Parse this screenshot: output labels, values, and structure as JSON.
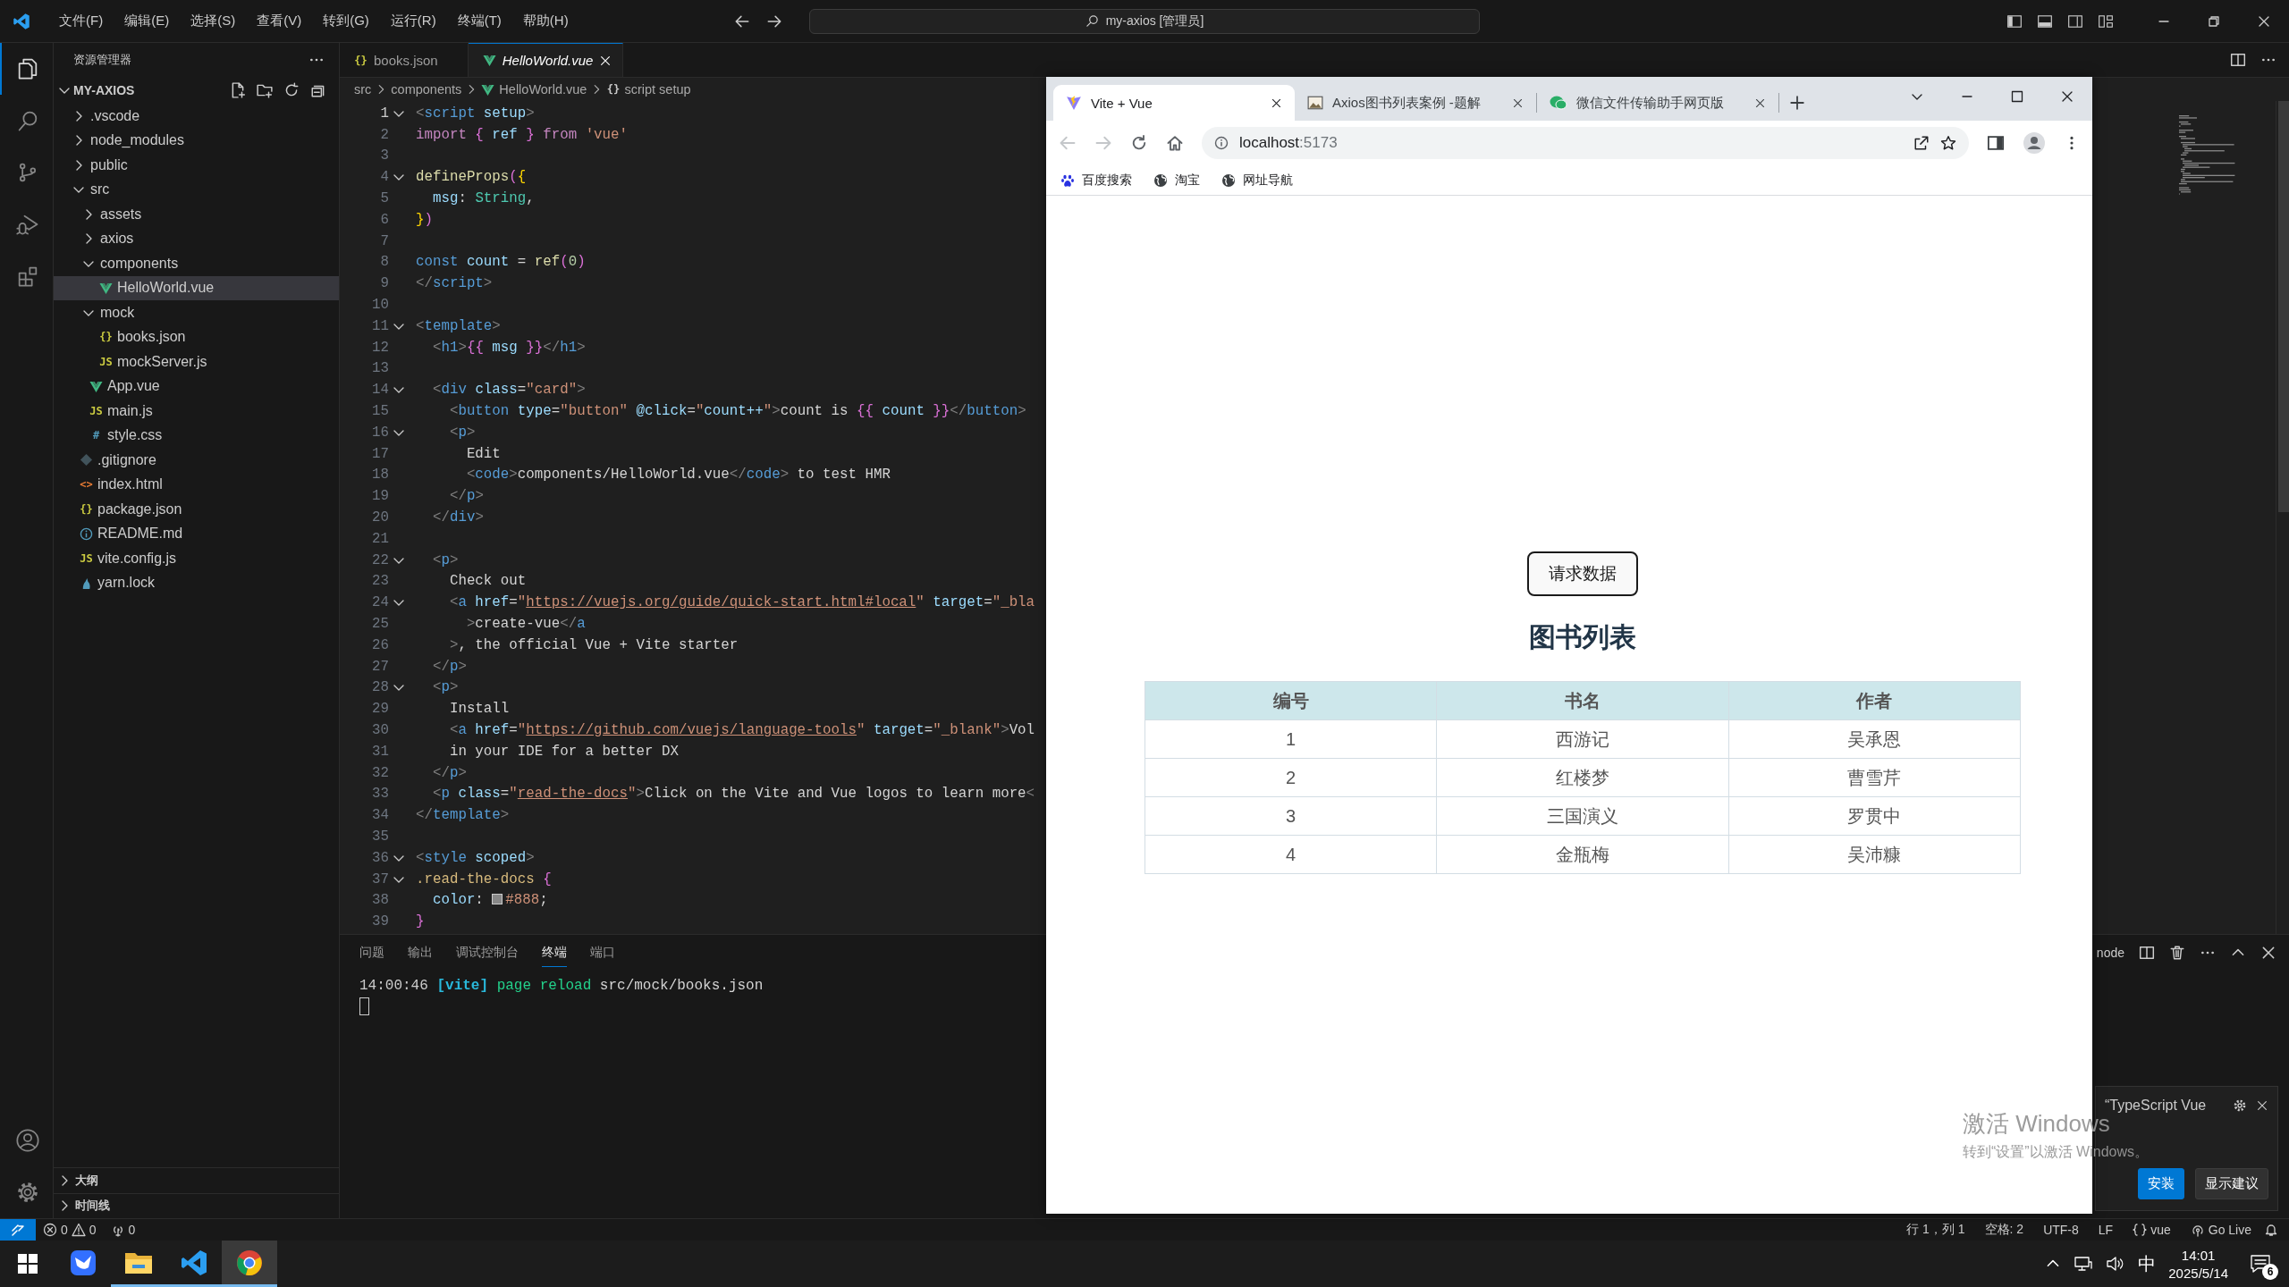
{
  "title_bar": {
    "menus": [
      "文件(F)",
      "编辑(E)",
      "选择(S)",
      "查看(V)",
      "转到(G)",
      "运行(R)",
      "终端(T)",
      "帮助(H)"
    ],
    "search": "my-axios [管理员]"
  },
  "activity_bar": {
    "items": [
      {
        "kind": "files",
        "selected": true
      },
      {
        "kind": "search",
        "selected": false
      },
      {
        "kind": "scm",
        "selected": false
      },
      {
        "kind": "debug",
        "selected": false
      },
      {
        "kind": "extensions",
        "selected": false
      }
    ]
  },
  "sidebar": {
    "title": "资源管理器",
    "project": "MY-AXIOS",
    "tree": [
      {
        "name": ".vscode",
        "kind": "folder",
        "expanded": false,
        "selected": false
      },
      {
        "name": "node_modules",
        "kind": "folder",
        "expanded": false,
        "selected": false
      },
      {
        "name": "public",
        "kind": "folder",
        "expanded": false,
        "selected": false
      },
      {
        "name": "src",
        "kind": "folder",
        "expanded": true,
        "selected": false,
        "children": [
          {
            "name": "assets",
            "kind": "folder",
            "expanded": false,
            "selected": false
          },
          {
            "name": "axios",
            "kind": "folder",
            "expanded": false,
            "selected": false
          },
          {
            "name": "components",
            "kind": "folder",
            "expanded": true,
            "selected": false,
            "children": [
              {
                "name": "HelloWorld.vue",
                "kind": "vue",
                "selected": true
              }
            ]
          },
          {
            "name": "mock",
            "kind": "folder",
            "expanded": true,
            "selected": false,
            "children": [
              {
                "name": "books.json",
                "kind": "json",
                "icon": "{}",
                "selected": false
              },
              {
                "name": "mockServer.js",
                "kind": "js",
                "icon": "JS",
                "selected": false
              }
            ]
          },
          {
            "name": "App.vue",
            "kind": "vue",
            "selected": false
          },
          {
            "name": "main.js",
            "kind": "js",
            "icon": "JS",
            "selected": false
          },
          {
            "name": "style.css",
            "kind": "css",
            "icon": "#",
            "selected": false
          }
        ]
      },
      {
        "name": ".gitignore",
        "kind": "git",
        "selected": false
      },
      {
        "name": "index.html",
        "kind": "html",
        "icon": "<>",
        "selected": false
      },
      {
        "name": "package.json",
        "kind": "json",
        "icon": "{}",
        "selected": false
      },
      {
        "name": "README.md",
        "kind": "info",
        "selected": false
      },
      {
        "name": "vite.config.js",
        "kind": "js",
        "icon": "JS",
        "selected": false
      },
      {
        "name": "yarn.lock",
        "kind": "yarn",
        "selected": false
      }
    ],
    "sections": [
      {
        "label": "大纲",
        "expanded": false
      },
      {
        "label": "时间线",
        "expanded": false
      }
    ]
  },
  "editor": {
    "tabs": [
      {
        "label": "books.json",
        "kind": "json",
        "icon": "{}",
        "selected": false,
        "preview": false
      },
      {
        "label": "HelloWorld.vue",
        "kind": "vue",
        "selected": true,
        "preview": true
      }
    ],
    "breadcrumb": [
      {
        "label": "src",
        "kind": "folder"
      },
      {
        "label": "components",
        "kind": "folder"
      },
      {
        "label": "HelloWorld.vue",
        "kind": "vue"
      },
      {
        "label": "script setup",
        "kind": "symbol",
        "icon": "{}"
      }
    ],
    "lines": [
      {
        "n": "1",
        "foldable": true,
        "tokens": [
          {
            "kind": "br",
            "text": "<"
          },
          {
            "kind": "tag",
            "text": "script"
          },
          {
            "kind": "attr",
            "text": " setup"
          },
          {
            "kind": "br",
            "text": ">"
          }
        ]
      },
      {
        "n": "2",
        "foldable": false,
        "tokens": [
          {
            "kind": "kw",
            "text": "import "
          },
          {
            "kind": "brace",
            "text": "{"
          },
          {
            "kind": "var",
            "text": " ref "
          },
          {
            "kind": "brace",
            "text": "}"
          },
          {
            "kind": "kw",
            "text": " from "
          },
          {
            "kind": "str",
            "text": "'vue'"
          }
        ]
      },
      {
        "n": "3",
        "foldable": false
      },
      {
        "n": "4",
        "foldable": true,
        "tokens": [
          {
            "kind": "fn",
            "text": "defineProps"
          },
          {
            "kind": "brace",
            "text": "("
          },
          {
            "kind": "brace2",
            "text": "{"
          }
        ]
      },
      {
        "n": "5",
        "foldable": false,
        "tokens": [
          {
            "kind": "var",
            "text": "  msg"
          },
          {
            "kind": "txt",
            "text": ": "
          },
          {
            "kind": "type",
            "text": "String"
          },
          {
            "kind": "txt",
            "text": ","
          }
        ]
      },
      {
        "n": "6",
        "foldable": false,
        "tokens": [
          {
            "kind": "brace2",
            "text": "}"
          },
          {
            "kind": "brace",
            "text": ")"
          }
        ]
      },
      {
        "n": "7",
        "foldable": false
      },
      {
        "n": "8",
        "foldable": false,
        "tokens": [
          {
            "kind": "tag",
            "text": "const"
          },
          {
            "kind": "var",
            "text": " count"
          },
          {
            "kind": "txt",
            "text": " = "
          },
          {
            "kind": "fn",
            "text": "ref"
          },
          {
            "kind": "brace",
            "text": "("
          },
          {
            "kind": "num",
            "text": "0"
          },
          {
            "kind": "brace",
            "text": ")"
          }
        ]
      },
      {
        "n": "9",
        "foldable": false,
        "tokens": [
          {
            "kind": "br",
            "text": "</"
          },
          {
            "kind": "tag",
            "text": "script"
          },
          {
            "kind": "br",
            "text": ">"
          }
        ]
      },
      {
        "n": "10",
        "foldable": false
      },
      {
        "n": "11",
        "foldable": true,
        "tokens": [
          {
            "kind": "br",
            "text": "<"
          },
          {
            "kind": "tag",
            "text": "template"
          },
          {
            "kind": "br",
            "text": ">"
          }
        ]
      },
      {
        "n": "12",
        "foldable": false,
        "tokens": [
          {
            "kind": "br",
            "text": "  <"
          },
          {
            "kind": "tag",
            "text": "h1"
          },
          {
            "kind": "br",
            "text": ">"
          },
          {
            "kind": "brace",
            "text": "{{"
          },
          {
            "kind": "var",
            "text": " msg "
          },
          {
            "kind": "brace",
            "text": "}}"
          },
          {
            "kind": "br",
            "text": "</"
          },
          {
            "kind": "tag",
            "text": "h1"
          },
          {
            "kind": "br",
            "text": ">"
          }
        ]
      },
      {
        "n": "13",
        "foldable": false
      },
      {
        "n": "14",
        "foldable": true,
        "tokens": [
          {
            "kind": "br",
            "text": "  <"
          },
          {
            "kind": "tag",
            "text": "div"
          },
          {
            "kind": "attr",
            "text": " class"
          },
          {
            "kind": "txt",
            "text": "="
          },
          {
            "kind": "str",
            "text": "\"card\""
          },
          {
            "kind": "br",
            "text": ">"
          }
        ]
      },
      {
        "n": "15",
        "foldable": false,
        "tokens": [
          {
            "kind": "br",
            "text": "    <"
          },
          {
            "kind": "tag",
            "text": "button"
          },
          {
            "kind": "attr",
            "text": " type"
          },
          {
            "kind": "txt",
            "text": "="
          },
          {
            "kind": "str",
            "text": "\"button\""
          },
          {
            "kind": "attr",
            "text": " @click"
          },
          {
            "kind": "txt",
            "text": "="
          },
          {
            "kind": "str",
            "text": "\""
          },
          {
            "kind": "var",
            "text": "count++"
          },
          {
            "kind": "str",
            "text": "\""
          },
          {
            "kind": "br",
            "text": ">"
          },
          {
            "kind": "txt",
            "text": "count is "
          },
          {
            "kind": "brace",
            "text": "{{"
          },
          {
            "kind": "var",
            "text": " count "
          },
          {
            "kind": "brace",
            "text": "}}"
          },
          {
            "kind": "br",
            "text": "</"
          },
          {
            "kind": "tag",
            "text": "button"
          },
          {
            "kind": "br",
            "text": ">"
          }
        ]
      },
      {
        "n": "16",
        "foldable": true,
        "tokens": [
          {
            "kind": "br",
            "text": "    <"
          },
          {
            "kind": "tag",
            "text": "p"
          },
          {
            "kind": "br",
            "text": ">"
          }
        ]
      },
      {
        "n": "17",
        "foldable": false,
        "tokens": [
          {
            "kind": "txt",
            "text": "      Edit"
          }
        ]
      },
      {
        "n": "18",
        "foldable": false,
        "tokens": [
          {
            "kind": "br",
            "text": "      <"
          },
          {
            "kind": "tag",
            "text": "code"
          },
          {
            "kind": "br",
            "text": ">"
          },
          {
            "kind": "txt",
            "text": "components/HelloWorld.vue"
          },
          {
            "kind": "br",
            "text": "</"
          },
          {
            "kind": "tag",
            "text": "code"
          },
          {
            "kind": "br",
            "text": ">"
          },
          {
            "kind": "txt",
            "text": " to test HMR"
          }
        ]
      },
      {
        "n": "19",
        "foldable": false,
        "tokens": [
          {
            "kind": "br",
            "text": "    </"
          },
          {
            "kind": "tag",
            "text": "p"
          },
          {
            "kind": "br",
            "text": ">"
          }
        ]
      },
      {
        "n": "20",
        "foldable": false,
        "tokens": [
          {
            "kind": "br",
            "text": "  </"
          },
          {
            "kind": "tag",
            "text": "div"
          },
          {
            "kind": "br",
            "text": ">"
          }
        ]
      },
      {
        "n": "21",
        "foldable": false
      },
      {
        "n": "22",
        "foldable": true,
        "tokens": [
          {
            "kind": "br",
            "text": "  <"
          },
          {
            "kind": "tag",
            "text": "p"
          },
          {
            "kind": "br",
            "text": ">"
          }
        ]
      },
      {
        "n": "23",
        "foldable": false,
        "tokens": [
          {
            "kind": "txt",
            "text": "    Check out"
          }
        ]
      },
      {
        "n": "24",
        "foldable": true,
        "tokens": [
          {
            "kind": "br",
            "text": "    <"
          },
          {
            "kind": "tag",
            "text": "a"
          },
          {
            "kind": "attr",
            "text": " href"
          },
          {
            "kind": "txt",
            "text": "="
          },
          {
            "kind": "str",
            "text": "\""
          },
          {
            "kind": "link",
            "text": "https://vuejs.org/guide/quick-start.html#local"
          },
          {
            "kind": "str",
            "text": "\""
          },
          {
            "kind": "attr",
            "text": " target"
          },
          {
            "kind": "txt",
            "text": "="
          },
          {
            "kind": "str",
            "text": "\"_bla"
          }
        ]
      },
      {
        "n": "25",
        "foldable": false,
        "tokens": [
          {
            "kind": "br",
            "text": "      >"
          },
          {
            "kind": "txt",
            "text": "create-vue"
          },
          {
            "kind": "br",
            "text": "</"
          },
          {
            "kind": "tag",
            "text": "a"
          }
        ]
      },
      {
        "n": "26",
        "foldable": false,
        "tokens": [
          {
            "kind": "br",
            "text": "    >"
          },
          {
            "kind": "txt",
            "text": ", the official Vue + Vite starter"
          }
        ]
      },
      {
        "n": "27",
        "foldable": false,
        "tokens": [
          {
            "kind": "br",
            "text": "  </"
          },
          {
            "kind": "tag",
            "text": "p"
          },
          {
            "kind": "br",
            "text": ">"
          }
        ]
      },
      {
        "n": "28",
        "foldable": true,
        "tokens": [
          {
            "kind": "br",
            "text": "  <"
          },
          {
            "kind": "tag",
            "text": "p"
          },
          {
            "kind": "br",
            "text": ">"
          }
        ]
      },
      {
        "n": "29",
        "foldable": false,
        "tokens": [
          {
            "kind": "txt",
            "text": "    Install"
          }
        ]
      },
      {
        "n": "30",
        "foldable": false,
        "tokens": [
          {
            "kind": "br",
            "text": "    <"
          },
          {
            "kind": "tag",
            "text": "a"
          },
          {
            "kind": "attr",
            "text": " href"
          },
          {
            "kind": "txt",
            "text": "="
          },
          {
            "kind": "str",
            "text": "\""
          },
          {
            "kind": "link",
            "text": "https://github.com/vuejs/language-tools"
          },
          {
            "kind": "str",
            "text": "\""
          },
          {
            "kind": "attr",
            "text": " target"
          },
          {
            "kind": "txt",
            "text": "="
          },
          {
            "kind": "str",
            "text": "\"_blank\""
          },
          {
            "kind": "br",
            "text": ">"
          },
          {
            "kind": "txt",
            "text": "Vol"
          }
        ]
      },
      {
        "n": "31",
        "foldable": false,
        "tokens": [
          {
            "kind": "txt",
            "text": "    in your IDE for a better DX"
          }
        ]
      },
      {
        "n": "32",
        "foldable": false,
        "tokens": [
          {
            "kind": "br",
            "text": "  </"
          },
          {
            "kind": "tag",
            "text": "p"
          },
          {
            "kind": "br",
            "text": ">"
          }
        ]
      },
      {
        "n": "33",
        "foldable": false,
        "tokens": [
          {
            "kind": "br",
            "text": "  <"
          },
          {
            "kind": "tag",
            "text": "p"
          },
          {
            "kind": "attr",
            "text": " class"
          },
          {
            "kind": "txt",
            "text": "="
          },
          {
            "kind": "str",
            "text": "\""
          },
          {
            "kind": "link",
            "text": "read-the-docs"
          },
          {
            "kind": "str",
            "text": "\""
          },
          {
            "kind": "br",
            "text": ">"
          },
          {
            "kind": "txt",
            "text": "Click on the Vite and Vue logos to learn more"
          },
          {
            "kind": "br",
            "text": "<"
          }
        ]
      },
      {
        "n": "34",
        "foldable": false,
        "tokens": [
          {
            "kind": "br",
            "text": "</"
          },
          {
            "kind": "tag",
            "text": "template"
          },
          {
            "kind": "br",
            "text": ">"
          }
        ]
      },
      {
        "n": "35",
        "foldable": false
      },
      {
        "n": "36",
        "foldable": true,
        "tokens": [
          {
            "kind": "br",
            "text": "<"
          },
          {
            "kind": "tag",
            "text": "style"
          },
          {
            "kind": "attr",
            "text": " scoped"
          },
          {
            "kind": "br",
            "text": ">"
          }
        ]
      },
      {
        "n": "37",
        "foldable": true,
        "tokens": [
          {
            "kind": "sel",
            "text": ".read-the-docs "
          },
          {
            "kind": "brace",
            "text": "{"
          }
        ]
      },
      {
        "n": "38",
        "foldable": false,
        "tokens": [
          {
            "kind": "prop",
            "text": "  color"
          },
          {
            "kind": "txt",
            "text": ": "
          },
          {
            "kind": "swatch",
            "text": "#888"
          },
          {
            "kind": "txt",
            "text": ";"
          }
        ]
      },
      {
        "n": "39",
        "foldable": false,
        "tokens": [
          {
            "kind": "brace",
            "text": "}"
          }
        ]
      }
    ]
  },
  "panel": {
    "tabs": [
      {
        "label": "问题",
        "selected": false
      },
      {
        "label": "输出",
        "selected": false
      },
      {
        "label": "调试控制台",
        "selected": false
      },
      {
        "label": "终端",
        "selected": true
      },
      {
        "label": "端口",
        "selected": false
      }
    ],
    "terminal_name": "node",
    "terminal": [
      {
        "kind": "time",
        "text": "14:00:46 "
      },
      {
        "kind": "vite",
        "text": "[vite]"
      },
      {
        "kind": "green",
        "text": " page reload"
      },
      {
        "kind": "txt",
        "text": " src/mock/books.json"
      }
    ]
  },
  "status_bar": {
    "errors": "0",
    "warnings": "0",
    "ports": "0",
    "right": [
      {
        "kind": "text",
        "label": "行 1，列 1"
      },
      {
        "kind": "text",
        "label": "空格: 2"
      },
      {
        "kind": "text",
        "label": "UTF-8"
      },
      {
        "kind": "text",
        "label": "LF"
      },
      {
        "kind": "language",
        "label": "vue"
      },
      {
        "kind": "live",
        "label": "Go Live"
      }
    ]
  },
  "notification": {
    "text": "“TypeScript Vue",
    "buttons": [
      {
        "label": "安装",
        "primary": true
      },
      {
        "label": "显示建议",
        "primary": false
      }
    ]
  },
  "activation": {
    "title": "激活 Windows",
    "hint": "转到“设置”以激活 Windows。"
  },
  "browser": {
    "tabs": [
      {
        "title": "Vite + Vue",
        "kind": "vite",
        "selected": true
      },
      {
        "title": "Axios图书列表案例 -题解",
        "kind": "picture",
        "selected": false
      },
      {
        "title": "微信文件传输助手网页版",
        "kind": "wechat",
        "selected": false
      }
    ],
    "address": {
      "host": "localhost",
      "port": ":5173"
    },
    "bookmarks": [
      {
        "label": "百度搜索",
        "kind": "baidu"
      },
      {
        "label": "淘宝",
        "kind": "globe"
      },
      {
        "label": "网址导航",
        "kind": "globe"
      }
    ],
    "page": {
      "button": "请求数据",
      "heading": "图书列表",
      "table": {
        "columns": [
          "编号",
          "书名",
          "作者"
        ],
        "rows": [
          [
            "1",
            "西游记",
            "吴承恩"
          ],
          [
            "2",
            "红楼梦",
            "曹雪芹"
          ],
          [
            "3",
            "三国演义",
            "罗贯中"
          ],
          [
            "4",
            "金瓶梅",
            "吴沛糠"
          ]
        ]
      }
    }
  },
  "taskbar": {
    "apps": [
      {
        "kind": "feishu",
        "running": false,
        "selected": false
      },
      {
        "kind": "explorer",
        "running": true,
        "selected": false
      },
      {
        "kind": "vscode",
        "running": true,
        "selected": false
      },
      {
        "kind": "chrome",
        "running": true,
        "selected": true
      }
    ],
    "ime": "中",
    "time": "14:01",
    "date": "2025/5/14",
    "notifications": "6"
  }
}
